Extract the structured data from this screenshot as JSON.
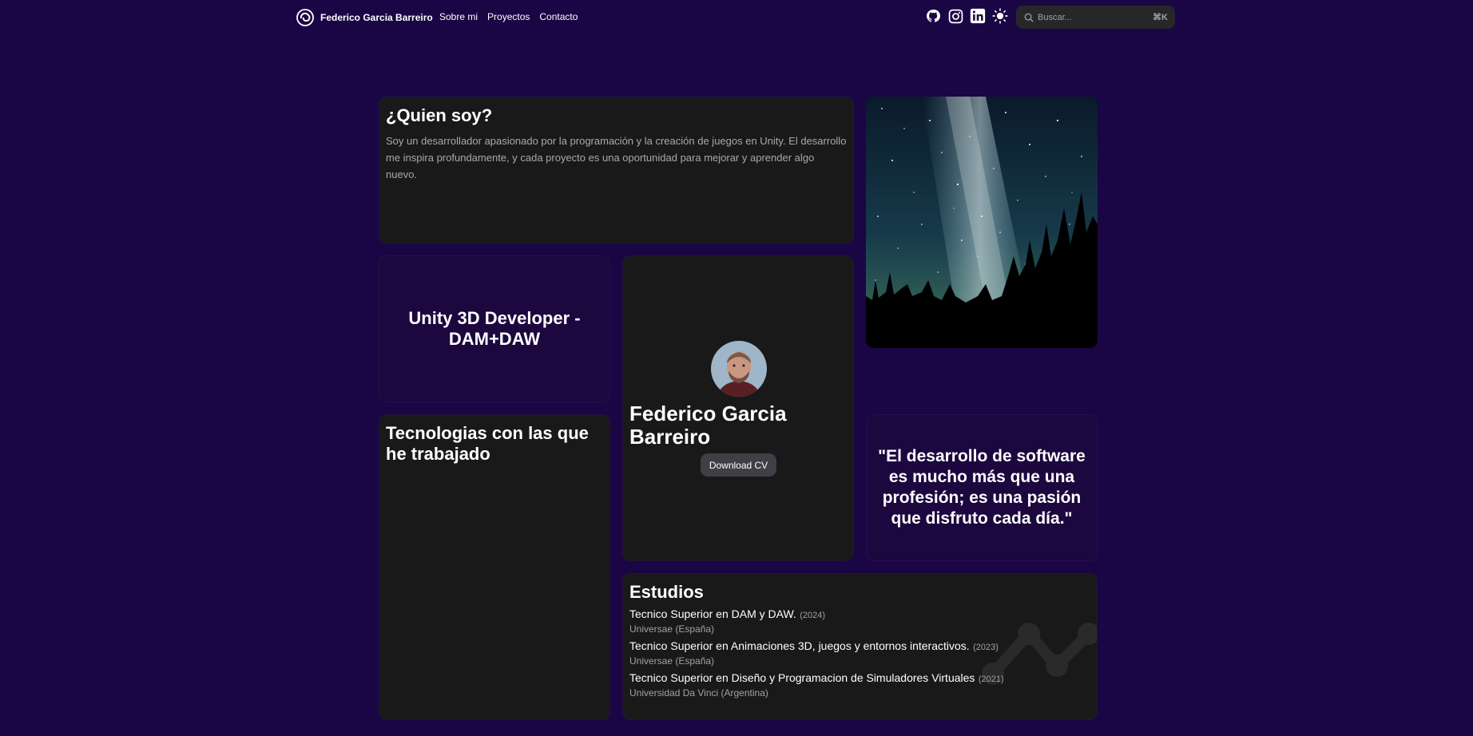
{
  "nav": {
    "brand": "Federico Garcia Barreiro",
    "links": [
      "Sobre mi",
      "Proyectos",
      "Contacto"
    ],
    "icons": [
      "github-icon",
      "instagram-icon",
      "linkedin-icon",
      "sun-icon"
    ],
    "search_placeholder": "Buscar...",
    "search_shortcut": "⌘K"
  },
  "about": {
    "title": "¿Quien soy?",
    "text": "Soy un desarrollador apasionado por la programación y la creación de juegos en Unity. El desarrollo me inspira profundamente, y cada proyecto es una oportunidad para mejorar y aprender algo nuevo."
  },
  "role": "Unity 3D Developer - DAM+DAW",
  "profile": {
    "name": "Federico Garcia Barreiro",
    "cv_button": "Download CV"
  },
  "quote": "\"El desarrollo de software es mucho más que una profesión; es una pasión que disfruto cada día.\"",
  "tech": {
    "title": "Tecnologias con las que he trabajado"
  },
  "studies": {
    "title": "Estudios",
    "items": [
      {
        "title": "Tecnico Superior en DAM y DAW.",
        "year": "(2024)",
        "school": "Universae (España)"
      },
      {
        "title": "Tecnico Superior en Animaciones 3D, juegos y entornos interactivos.",
        "year": "(2023)",
        "school": "Universae (España)"
      },
      {
        "title": "Tecnico Superior en Diseño y Programacion de Simuladores Virtuales",
        "year": "(2021)",
        "school": "Universidad Da Vinci (Argentina)"
      }
    ]
  },
  "colors": {
    "background": "#1a0644",
    "card": "#191919",
    "card_purple": "#1c073f"
  }
}
